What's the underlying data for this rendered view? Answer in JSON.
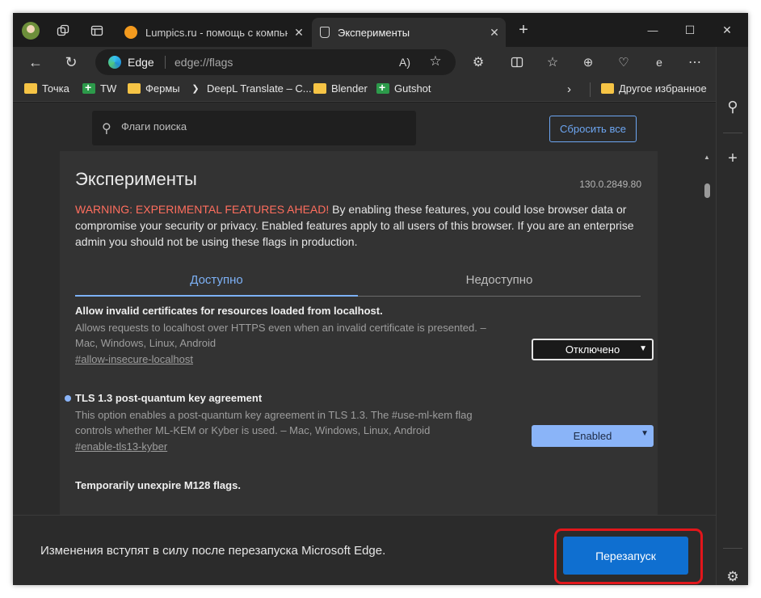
{
  "window": {
    "tabs": [
      {
        "title": "Lumpics.ru - помощь с компьют",
        "icon": "lumpics-favicon"
      },
      {
        "title": "Эксперименты",
        "icon": "flask-icon"
      }
    ],
    "new_tab": "+",
    "controls": {
      "minimize": "—",
      "maximize": "☐",
      "close": "✕"
    }
  },
  "address_bar": {
    "site": "Edge",
    "url": "edge://flags"
  },
  "bookmarks": [
    {
      "label": "Точка",
      "icon": "folder"
    },
    {
      "label": "TW",
      "icon": "green-plus"
    },
    {
      "label": "Фермы",
      "icon": "folder"
    },
    {
      "label": "DeepL Translate – C...",
      "icon": "deepl"
    },
    {
      "label": "Blender",
      "icon": "folder"
    },
    {
      "label": "Gutshot",
      "icon": "green-plus"
    }
  ],
  "bookmarks_other": "Другое избранное",
  "search": {
    "placeholder": "Флаги поиска"
  },
  "reset_all": "Сбросить все",
  "page": {
    "title": "Эксперименты",
    "version": "130.0.2849.80",
    "warning_highlight": "WARNING: EXPERIMENTAL FEATURES AHEAD!",
    "warning_text": " By enabling these features, you could lose browser data or compromise your security or privacy. Enabled features apply to all users of this browser. If you are an enterprise admin you should not be using these flags in production."
  },
  "tabs_flags": {
    "available": "Доступно",
    "unavailable": "Недоступно"
  },
  "flags": [
    {
      "name": "Allow invalid certificates for resources loaded from localhost.",
      "description": "Allows requests to localhost over HTTPS even when an invalid certificate is presented. – Mac, Windows, Linux, Android",
      "link": "#allow-insecure-localhost",
      "value": "Отключено"
    },
    {
      "name": "TLS 1.3 post-quantum key agreement",
      "description": "This option enables a post-quantum key agreement in TLS 1.3. The #use-ml-kem flag controls whether ML-KEM or Kyber is used. – Mac, Windows, Linux, Android",
      "link": "#enable-tls13-kyber",
      "value": "Enabled"
    },
    {
      "name": "Temporarily unexpire M128 flags."
    }
  ],
  "restart": {
    "message": "Изменения вступят в силу после перезапуска Microsoft Edge.",
    "button": "Перезапуск"
  },
  "colors": {
    "accent": "#0f6fd0",
    "warning": "#ff6e5e",
    "highlight": "#e2161b",
    "link": "#7db1f6"
  }
}
